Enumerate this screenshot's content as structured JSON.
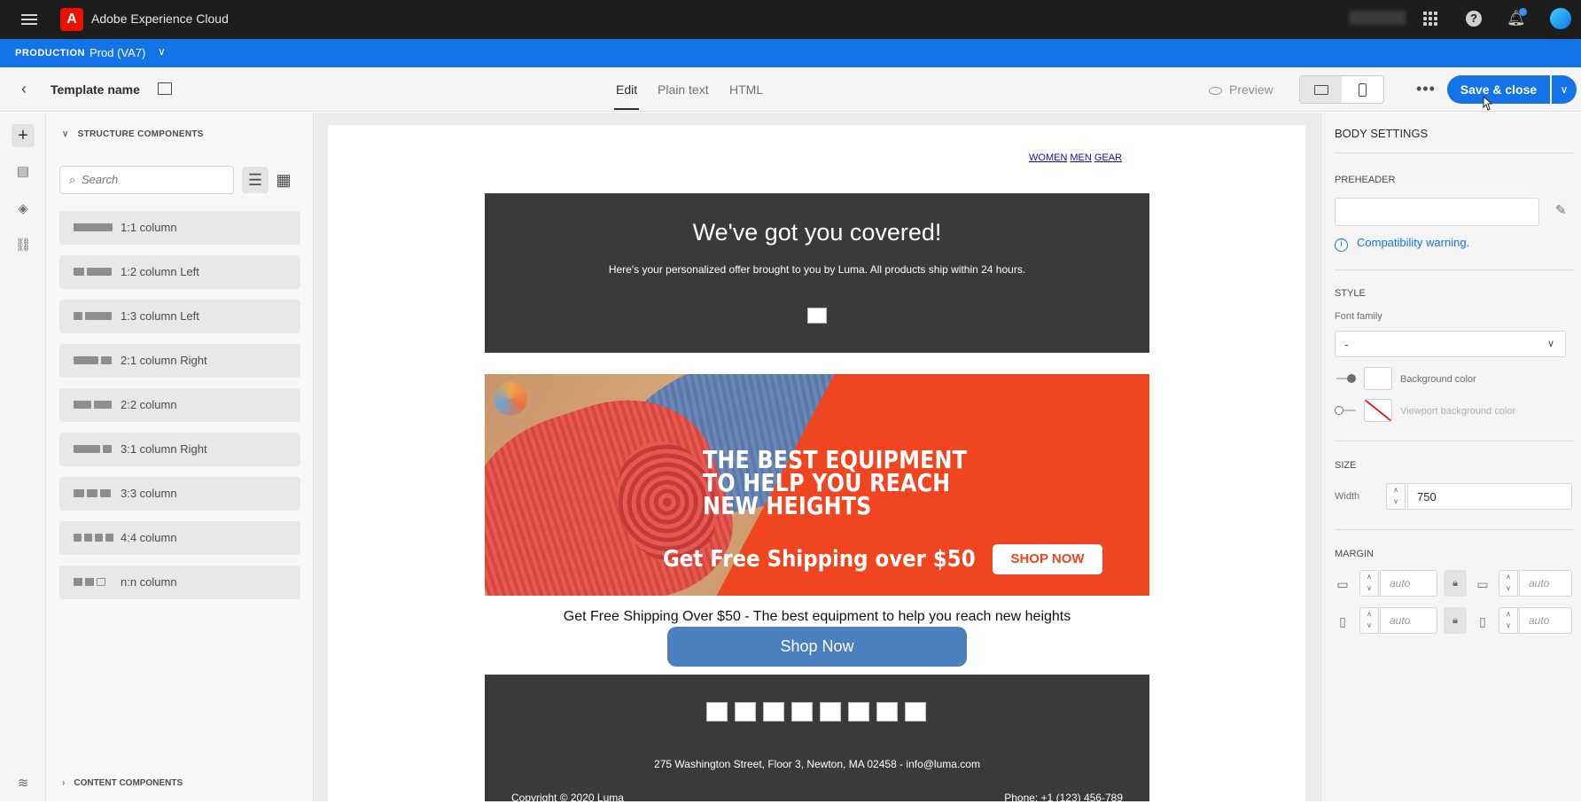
{
  "topbar": {
    "app_title": "Adobe Experience Cloud",
    "logo_letter": "A",
    "help_glyph": "?",
    "icons": [
      "menu-icon",
      "adobe-logo",
      "apps-grid-icon",
      "help-icon",
      "bell-icon",
      "avatar"
    ]
  },
  "env": {
    "label": "PRODUCTION",
    "name": "Prod (VA7)"
  },
  "header": {
    "template_name": "Template name",
    "tabs": [
      {
        "label": "Edit",
        "active": true
      },
      {
        "label": "Plain text"
      },
      {
        "label": "HTML"
      }
    ],
    "preview": "Preview",
    "more": "•••",
    "save_label": "Save & close"
  },
  "left_panel": {
    "section_title": "STRUCTURE COMPONENTS",
    "search_placeholder": "Search",
    "components": [
      {
        "label": "1:1 column"
      },
      {
        "label": "1:2 column Left"
      },
      {
        "label": "1:3 column Left"
      },
      {
        "label": "2:1 column Right"
      },
      {
        "label": "2:2 column"
      },
      {
        "label": "3:1 column Right"
      },
      {
        "label": "3:3 column"
      },
      {
        "label": "4:4 column"
      },
      {
        "label": "n:n column"
      }
    ],
    "content_section": "CONTENT COMPONENTS"
  },
  "email": {
    "nav": [
      "WOMEN",
      "MEN",
      "GEAR"
    ],
    "hero_title": "We've got you covered!",
    "hero_text": "Here's your personalized offer brought to you by Luma. All products ship within 24 hours.",
    "banner_headline": "THE BEST EQUIPMENT\nTO HELP YOU REACH\nNEW HEIGHTS",
    "banner_shipping": "Get Free Shipping over $50",
    "banner_button": "SHOP NOW",
    "caption": "Get Free Shipping Over $50 - The best equipment to help you reach new heights",
    "cta": "Shop Now",
    "address": "275 Washington Street, Floor 3, Newton, MA 02458 - info@luma.com",
    "copyright": "Copyright © 2020 Luma",
    "phone": "Phone: +1 (123) 456-789"
  },
  "right_panel": {
    "title": "BODY SETTINGS",
    "preheader_label": "PREHEADER",
    "compat_warning": "Compatibility warning.",
    "style_label": "STYLE",
    "font_family_label": "Font family",
    "font_family_value": "-",
    "bg_color_label": "Background color",
    "viewport_bg_label": "Viewport background color",
    "size_label": "SIZE",
    "width_label": "Width",
    "width_value": "750",
    "margin_label": "MARGIN",
    "margin_placeholder": "auto"
  },
  "colors": {
    "accent": "#1473e6",
    "topbar": "#1d1d1d",
    "email_dark": "#3a3a3a",
    "banner_orange": "#ef4520",
    "cta_blue": "#4a7fc0"
  }
}
